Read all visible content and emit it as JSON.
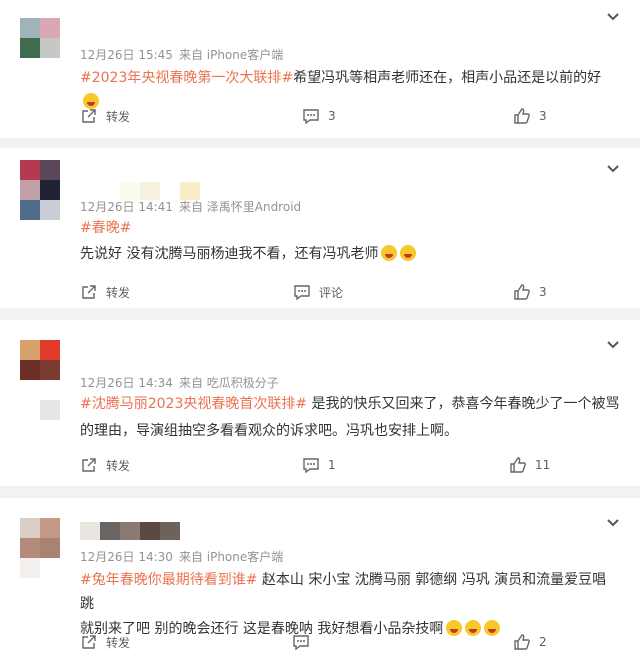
{
  "colors": {
    "hashtag": "#eb7350",
    "meta": "#939393",
    "text": "#333333",
    "card_bg": "#ffffff",
    "page_bg": "#f2f2f2"
  },
  "posts": [
    {
      "time": "12月26日 15:45",
      "source": "来自 iPhone客户端",
      "hashtag": "#2023年央视春晚第一次大联排#",
      "text": "希望冯巩等相声老师还在，相声小品还是以前的好",
      "text2": "",
      "emoji": "laugh",
      "repost_label": "转发",
      "comment_label": "3",
      "like_count": "3"
    },
    {
      "time": "12月26日 14:41",
      "source": "来自 泽禹怀里Android",
      "hashtag": "#春晚#",
      "text": "先说好 没有沈腾马丽杨迪我不看，还有冯巩老师",
      "text2": "",
      "emoji": "cry",
      "repost_label": "转发",
      "comment_label": "评论",
      "like_count": "3"
    },
    {
      "time": "12月26日 14:34",
      "source": "来自 吃瓜积极分子",
      "hashtag": "#沈腾马丽2023央视春晚首次联排#",
      "text": " 是我的快乐又回来了，恭喜今年春晚少了一个被骂",
      "text2": "的理由，导演组抽空多看看观众的诉求吧。冯巩也安排上啊。",
      "emoji": "",
      "repost_label": "转发",
      "comment_label": "1",
      "like_count": "11"
    },
    {
      "time": "12月26日 14:30",
      "source": "来自 iPhone客户端",
      "hashtag": "#兔年春晚你最期待看到谁#",
      "text": " 赵本山 宋小宝 沈腾马丽 郭德纲 冯巩 演员和流量爱豆唱跳",
      "text2": "就别来了吧 别的晚会还行 这是春晚呐 我好想看小品杂技啊",
      "emoji": "cry3",
      "repost_label": "转发",
      "comment_label": "",
      "like_count": "2"
    }
  ]
}
